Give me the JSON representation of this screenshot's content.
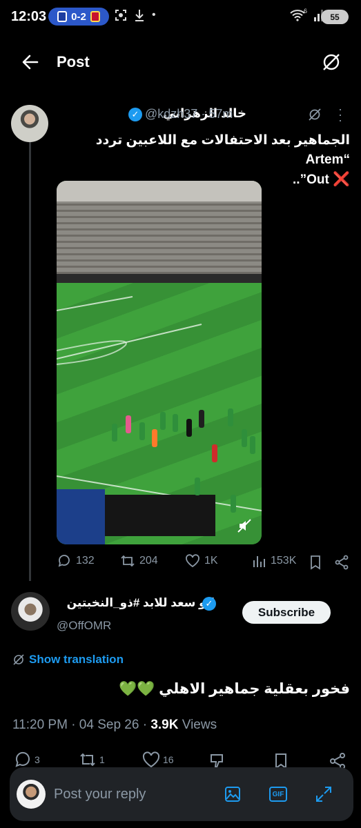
{
  "status_bar": {
    "time": "12:03",
    "score": "0-2",
    "network_label": "6",
    "battery": "55"
  },
  "header": {
    "title": "Post"
  },
  "tweet": {
    "author_name": "خالد الزهراني",
    "handle": "@kdzh37",
    "time": "57m",
    "text_line1": "الجماهير بعد الاحتفالات مع اللاعبين تردد “Artem",
    "text_line2": "Out”..",
    "text_emoji": "❌",
    "stats": {
      "replies": "132",
      "reposts": "204",
      "likes": "1K",
      "views": "153K"
    }
  },
  "reply": {
    "author_name": "ابو سعد للابد #ذو_النخبتين",
    "handle": "@OffOMR",
    "subscribe_label": "Subscribe",
    "translate_label": "Show translation",
    "text": "فخور بعقلية جماهير الاهلي",
    "emoji": "💚💚",
    "timestamp": "11:20 PM · 04 Sep 26 · ",
    "views_count": "3.9K",
    "views_label": "Views",
    "stats": {
      "replies": "3",
      "reposts": "1",
      "likes": "16"
    }
  },
  "composer": {
    "placeholder": "Post your reply",
    "gif_label": "GIF"
  },
  "colors": {
    "accent": "#1d9bf0",
    "background": "#000000",
    "muted": "#8b98a5"
  }
}
